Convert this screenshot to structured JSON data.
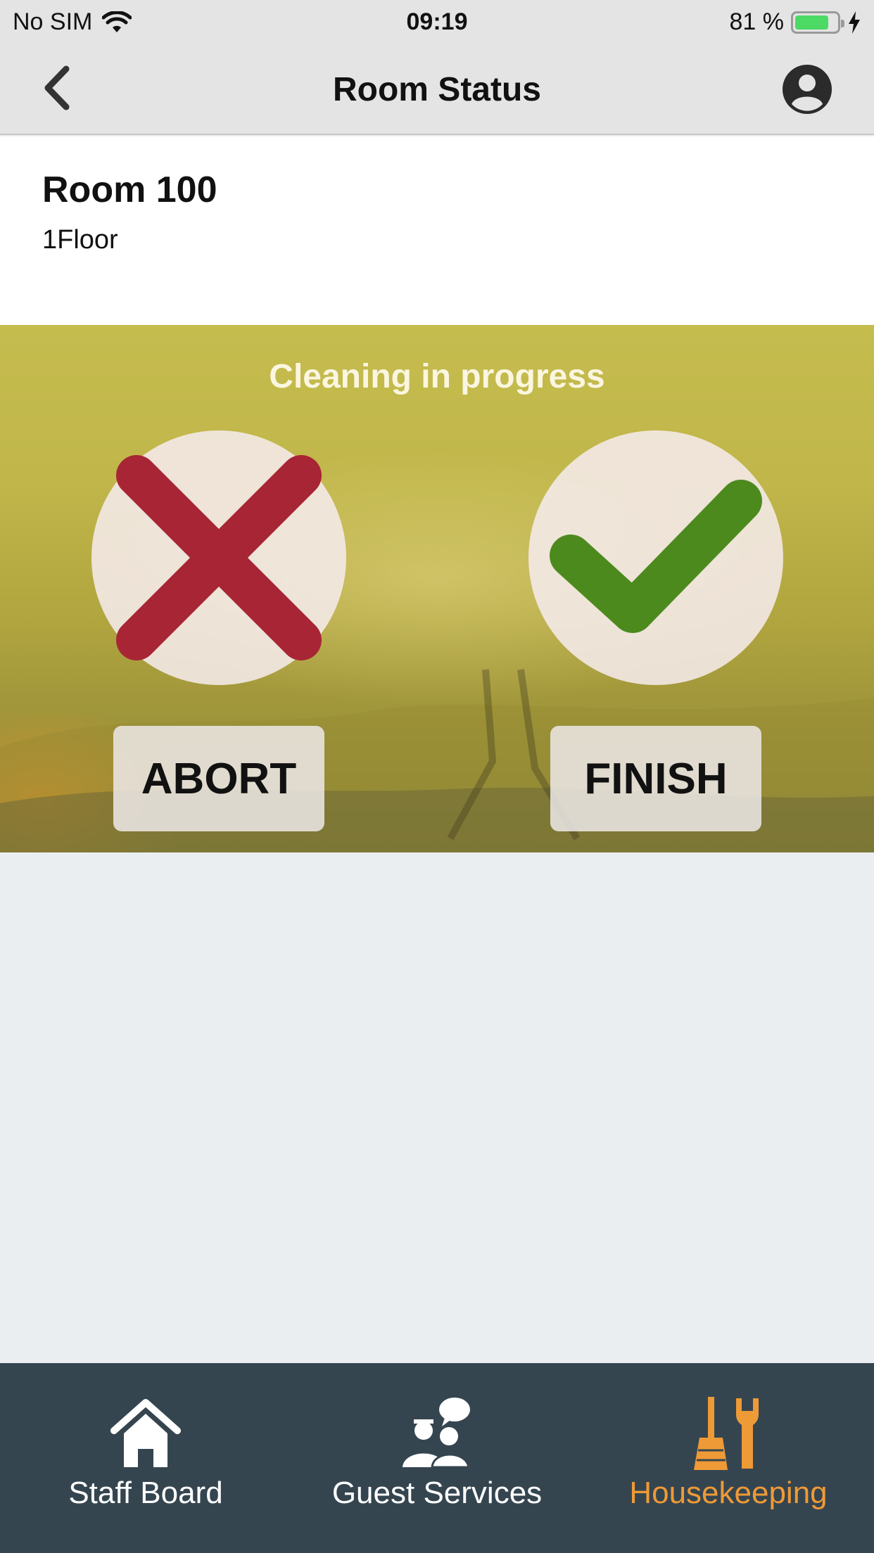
{
  "status_bar": {
    "carrier": "No SIM",
    "time": "09:19",
    "battery_percent": "81 %",
    "battery_level": 0.81
  },
  "nav": {
    "title": "Room Status",
    "back_icon": "chevron-left-icon",
    "profile_icon": "user-circle-icon"
  },
  "room": {
    "name": "Room 100",
    "floor": "1Floor"
  },
  "status_panel": {
    "title": "Cleaning in progress",
    "abort_label": "ABORT",
    "finish_label": "FINISH",
    "abort_color": "#a82535",
    "finish_color": "#4c8a1e"
  },
  "tabs": [
    {
      "label": "Staff Board",
      "icon": "home-icon",
      "active": false
    },
    {
      "label": "Guest Services",
      "icon": "guest-services-icon",
      "active": false
    },
    {
      "label": "Housekeeping",
      "icon": "housekeeping-icon",
      "active": true
    }
  ],
  "colors": {
    "tab_bar_bg": "#354550",
    "active_tab": "#ee9a36",
    "content_bg": "#eaeef0"
  }
}
